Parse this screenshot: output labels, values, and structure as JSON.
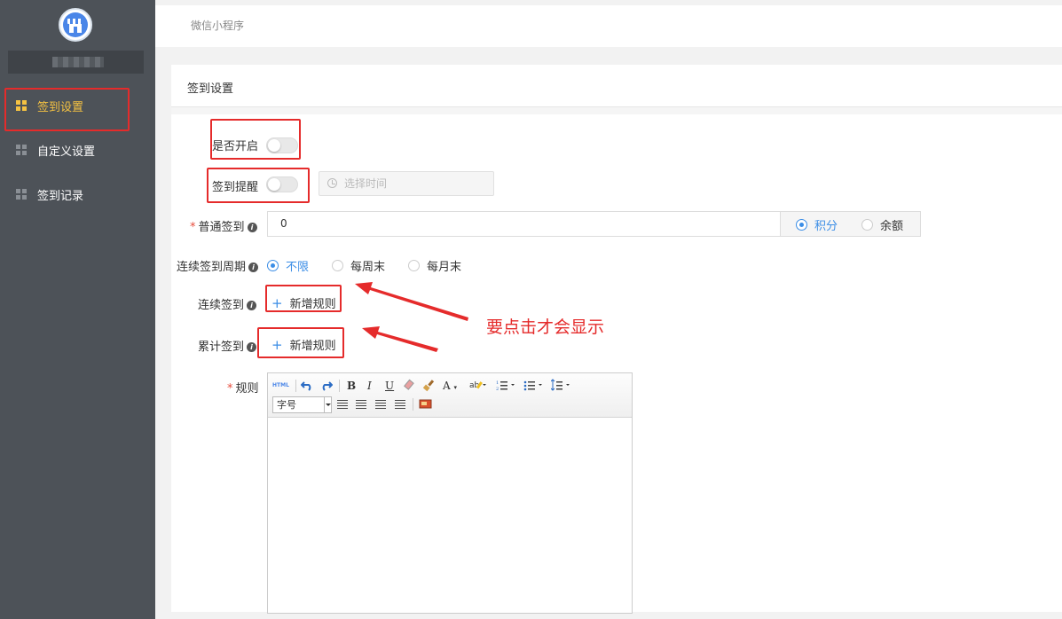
{
  "topbar": {
    "title": "微信小程序"
  },
  "sidebar": {
    "items": [
      {
        "label": "签到设置",
        "active": true
      },
      {
        "label": "自定义设置",
        "active": false
      },
      {
        "label": "签到记录",
        "active": false
      }
    ]
  },
  "panel": {
    "title": "签到设置"
  },
  "form": {
    "enable_label": "是否开启",
    "enable_on": false,
    "reminder_label": "签到提醒",
    "reminder_on": false,
    "time_placeholder": "选择时间",
    "normal_label": "普通签到",
    "normal_value": "0",
    "reward_options": [
      "积分",
      "余额"
    ],
    "reward_selected": "积分",
    "cycle_label": "连续签到周期",
    "cycle_options": [
      "不限",
      "每周末",
      "每月末"
    ],
    "cycle_selected": "不限",
    "continuous_label": "连续签到",
    "cumulative_label": "累计签到",
    "add_rule_label": "新增规则",
    "rule_label": "规则",
    "required_mark": "*",
    "info_icon": "i"
  },
  "editor": {
    "html_btn": "HTML",
    "bold": "B",
    "italic": "I",
    "underline": "U",
    "font_color": "A",
    "font_size_placeholder": "字号"
  },
  "annotation": {
    "text": "要点击才会显示"
  },
  "colors": {
    "sidebar_bg": "#4d5258",
    "active": "#f5c242",
    "accent": "#3c8ee6",
    "annotation": "#e52b2b"
  }
}
